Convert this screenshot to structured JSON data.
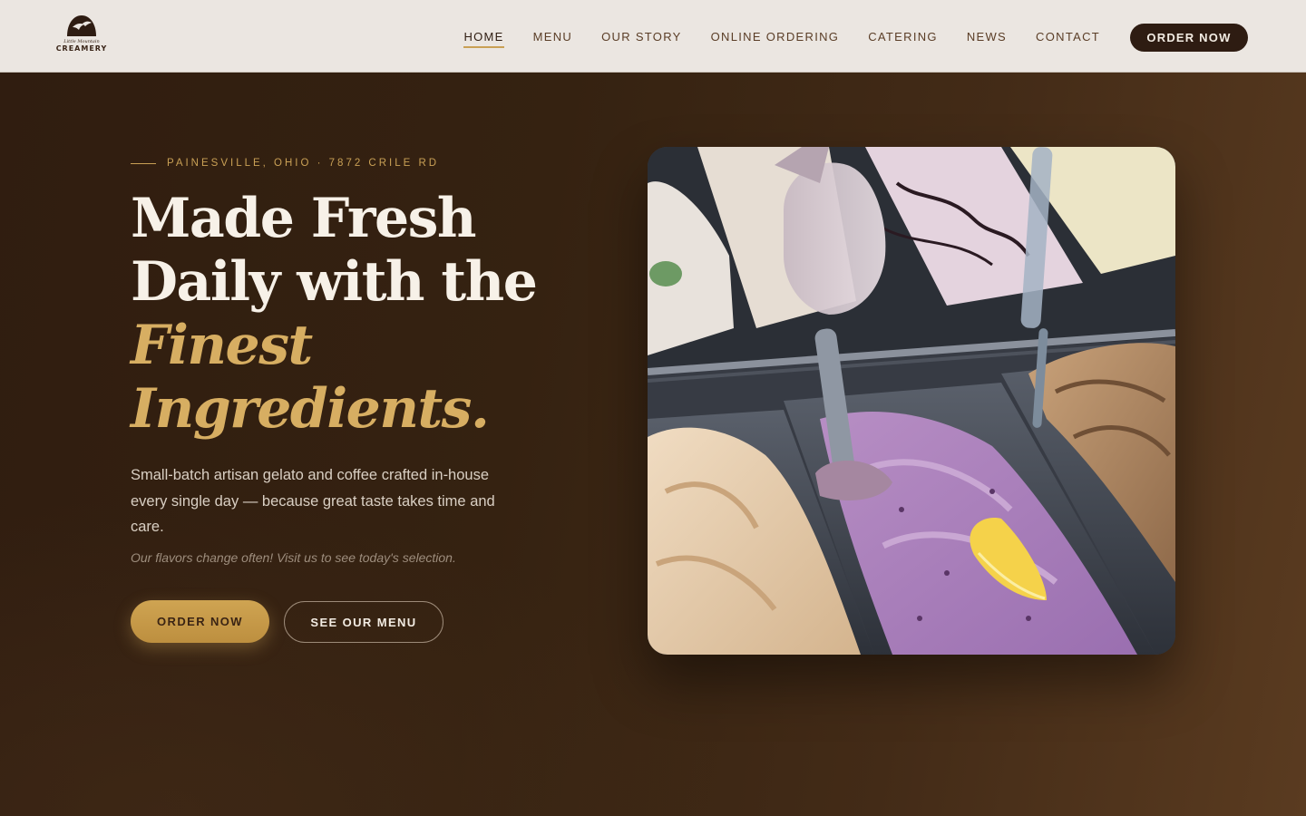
{
  "brand": {
    "script_line": "Little Mountain",
    "wordmark": "CREAMERY"
  },
  "nav": {
    "items": [
      {
        "label": "HOME",
        "active": true
      },
      {
        "label": "MENU",
        "active": false
      },
      {
        "label": "OUR STORY",
        "active": false
      },
      {
        "label": "ONLINE ORDERING",
        "active": false
      },
      {
        "label": "CATERING",
        "active": false
      },
      {
        "label": "NEWS",
        "active": false
      },
      {
        "label": "CONTACT",
        "active": false
      }
    ],
    "cta_label": "ORDER NOW"
  },
  "hero": {
    "eyebrow": "PAINESVILLE, OHIO · 7872 CRILE RD",
    "headline_line1": "Made Fresh",
    "headline_line2": "Daily with the",
    "headline_accent1": "Finest",
    "headline_accent2": "Ingredients.",
    "lede": "Small-batch artisan gelato and coffee crafted in-house every single day — because great taste takes time and care.",
    "note": "Our flavors change often! Visit us to see today's selection.",
    "primary_button": "ORDER NOW",
    "secondary_button": "SEE OUR MENU"
  },
  "colors": {
    "accent_gold": "#c9a055",
    "header_bg": "#ebe6e1",
    "hero_dark": "#301d10",
    "cta_dark": "#2e1c12"
  },
  "icons": {
    "logo": "mountain-bird-logo-icon"
  }
}
